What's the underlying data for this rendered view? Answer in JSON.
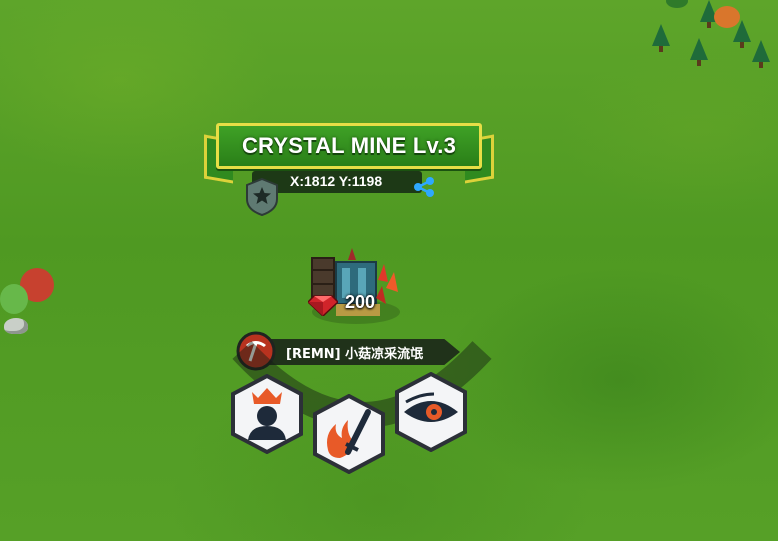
{
  "building": {
    "title": "CRYSTAL MINE Lv.3",
    "coordinates": "X:1812 Y:1198",
    "badge_icon": "star-shield-icon",
    "share_icon": "share-icon"
  },
  "resource": {
    "icon": "ruby-gem-icon",
    "amount": "200"
  },
  "occupant": {
    "icon": "pickaxe-icon",
    "name": "[REMN] 小菇凉采流氓"
  },
  "actions": [
    {
      "name": "commander-action",
      "icon": "crowned-silhouette-icon"
    },
    {
      "name": "attack-action",
      "icon": "flame-sword-icon"
    },
    {
      "name": "scout-action",
      "icon": "eye-icon"
    }
  ],
  "colors": {
    "grass": "#4f9922",
    "ribbon_green": "#2f8a1f",
    "ribbon_border": "#e7de46",
    "pick_badge": "#b8321f",
    "action_accent": "#e85a28"
  }
}
